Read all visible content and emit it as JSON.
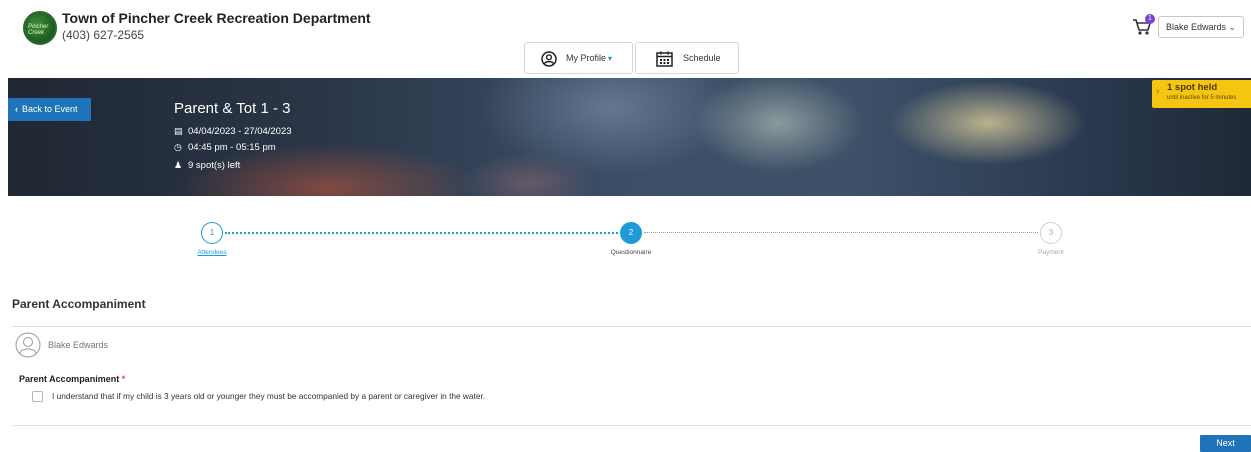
{
  "header": {
    "org_name": "Town of Pincher Creek Recreation Department",
    "phone": "(403) 627-2565",
    "logo_text": "Pincher Creek",
    "cart_count": "1",
    "user_name": "Blake Edwards"
  },
  "nav": {
    "profile_label": "My Profile",
    "schedule_label": "Schedule"
  },
  "event": {
    "back_label": "Back to Event",
    "title": "Parent & Tot 1 - 3",
    "dates": "04/04/2023 - 27/04/2023",
    "time": "04:45 pm - 05:15 pm",
    "spots": "9 spot(s) left"
  },
  "hold": {
    "title": "1 spot held",
    "subtitle": "until inactive for 5 minutes"
  },
  "steps": [
    {
      "number": "1",
      "label": "Attendees",
      "state": "done"
    },
    {
      "number": "2",
      "label": "Questionnaire",
      "state": "active"
    },
    {
      "number": "3",
      "label": "Payment",
      "state": "pending"
    }
  ],
  "form": {
    "section_title": "Parent Accompaniment",
    "attendee_name": "Blake Edwards",
    "question_label": "Parent Accompaniment",
    "required_mark": "*",
    "checkbox_label": "I understand that if my child is 3 years old or younger they must be accompanied by a parent or caregiver in the water.",
    "checkbox_checked": false,
    "next_label": "Next"
  },
  "colors": {
    "primary": "#1f73b8",
    "step_accent": "#1e9ad6",
    "hold_yellow": "#f6c512",
    "badge": "#7b3fd1",
    "required": "#d9534f"
  }
}
